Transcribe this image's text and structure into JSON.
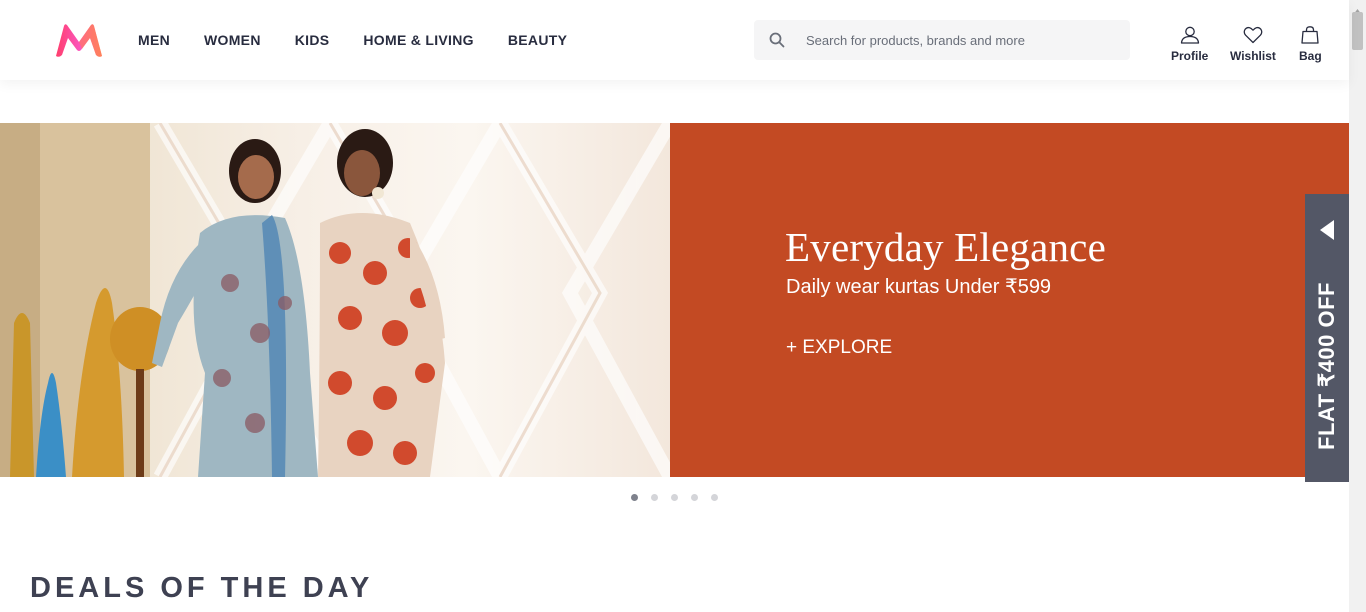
{
  "header": {
    "nav": [
      "MEN",
      "WOMEN",
      "KIDS",
      "HOME & LIVING",
      "BEAUTY"
    ],
    "search": {
      "placeholder": "Search for products, brands and more"
    },
    "actions": {
      "profile": "Profile",
      "wishlist": "Wishlist",
      "bag": "Bag"
    }
  },
  "banner": {
    "title": "Everyday Elegance",
    "subtitle": "Daily wear kurtas Under ₹599",
    "cta": "+ EXPLORE",
    "carousel": {
      "count": 5,
      "active": 1
    }
  },
  "side_promo": {
    "text": "FLAT ₹400 OFF"
  },
  "section": {
    "title": "DEALS OF THE DAY"
  },
  "colors": {
    "banner_orange": "#c34a23",
    "side_tab": "#535766",
    "text_dark": "#282c3f",
    "logo_pink": "#ff3f6c",
    "logo_orange": "#ff905a"
  }
}
